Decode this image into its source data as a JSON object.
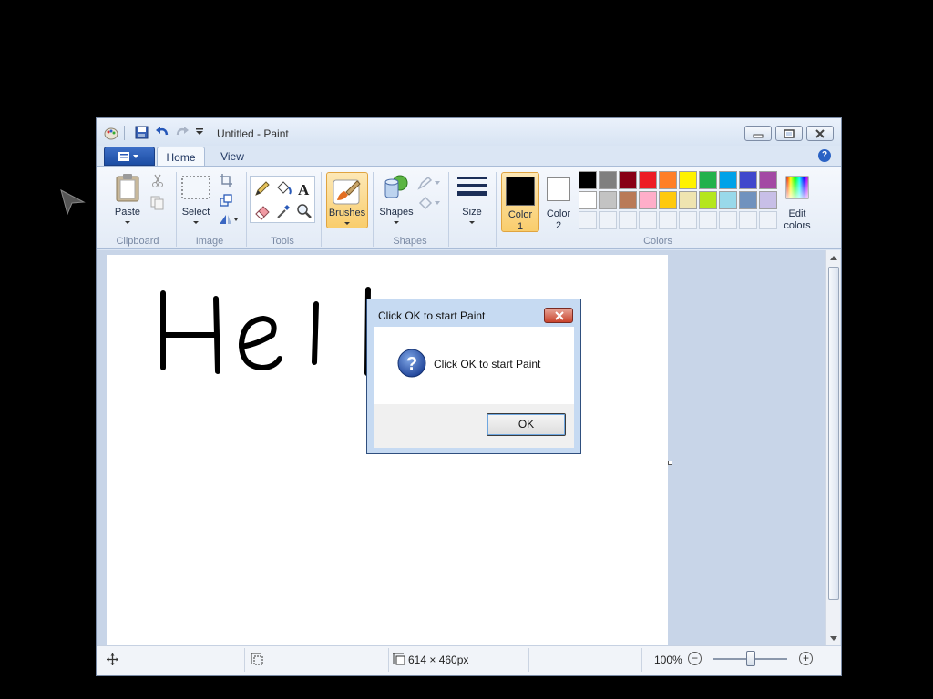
{
  "window": {
    "title": "Untitled - Paint"
  },
  "quick_access": {
    "icons": [
      "app-icon",
      "save-icon",
      "undo-icon",
      "redo-icon",
      "customize-dropdown-icon"
    ]
  },
  "ribbon": {
    "tabs": [
      {
        "label": "Home",
        "selected": true
      },
      {
        "label": "View",
        "selected": false
      }
    ],
    "groups": {
      "clipboard": {
        "label": "Clipboard",
        "paste_label": "Paste"
      },
      "image": {
        "label": "Image",
        "select_label": "Select"
      },
      "tools": {
        "label": "Tools"
      },
      "brushes": {
        "label": "Brushes"
      },
      "shapes": {
        "label": "Shapes",
        "shapes_label": "Shapes"
      },
      "size": {
        "label": "Size"
      },
      "colors": {
        "label": "Colors",
        "color1_label": "Color\n1",
        "color2_label": "Color\n2",
        "edit_label": "Edit\ncolors",
        "color1": "#000000",
        "color2": "#ffffff",
        "palette_row1": [
          "#000000",
          "#7f7f7f",
          "#880015",
          "#ed1c24",
          "#ff7f27",
          "#fff200",
          "#22b14c",
          "#00a2e8",
          "#3f48cc",
          "#a349a4"
        ],
        "palette_row2": [
          "#ffffff",
          "#c3c3c3",
          "#b97a57",
          "#ffaec9",
          "#ffc90e",
          "#efe4b0",
          "#b5e61d",
          "#99d9ea",
          "#7092be",
          "#c8bfe7"
        ]
      }
    }
  },
  "canvas": {
    "drawn_text": "Hell"
  },
  "status": {
    "dimensions": "614 × 460px",
    "zoom": "100%",
    "zoom_minus": "−",
    "zoom_plus": "+"
  },
  "dialog": {
    "title": "Click OK to start Paint",
    "message": "Click OK to start Paint",
    "ok_label": "OK"
  }
}
